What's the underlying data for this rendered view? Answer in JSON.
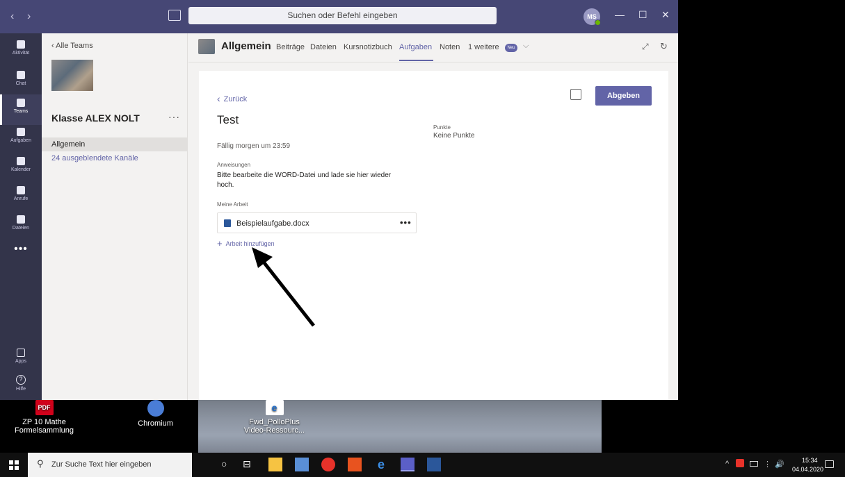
{
  "titlebar": {
    "search_placeholder": "Suchen oder Befehl eingeben",
    "avatar_initials": "MS",
    "back_arrow": "‹",
    "forward_arrow": "›",
    "minimize": "—",
    "maximize": "☐",
    "close": "✕"
  },
  "rail": {
    "items": [
      {
        "label": "Aktivität",
        "icon": "bell-icon"
      },
      {
        "label": "Chat",
        "icon": "chat-icon"
      },
      {
        "label": "Teams",
        "icon": "teams-icon"
      },
      {
        "label": "Aufgaben",
        "icon": "assignments-icon"
      },
      {
        "label": "Kalender",
        "icon": "calendar-icon"
      },
      {
        "label": "Anrufe",
        "icon": "phone-icon"
      },
      {
        "label": "Dateien",
        "icon": "files-icon"
      }
    ],
    "more": "•••",
    "apps_label": "Apps",
    "help_label": "Hilfe",
    "help_glyph": "?"
  },
  "teampanel": {
    "back_label": "‹  Alle Teams",
    "team_name": "Klasse ALEX NOLT",
    "more": "···",
    "channel_active": "Allgemein",
    "hidden_channels": "24 ausgeblendete Kanäle"
  },
  "channel_header": {
    "title": "Allgemein",
    "tabs": [
      "Beiträge",
      "Dateien",
      "Kursnotizbuch",
      "Aufgaben",
      "Noten",
      "1 weitere"
    ],
    "active_tab": "Aufgaben",
    "new_badge": "Neu",
    "chevron": "⌵",
    "expand_icon": "⤢",
    "refresh_icon": "↻"
  },
  "assignment": {
    "back_label": "Zurück",
    "back_chevron": "‹",
    "submit_label": "Abgeben",
    "title": "Test",
    "due": "Fällig morgen um 23:59",
    "points_label": "Punkte",
    "points_value": "Keine Punkte",
    "instructions_label": "Anweisungen",
    "instructions_text": "Bitte bearbeite die WORD-Datei und lade sie hier wieder hoch.",
    "my_work_label": "Meine Arbeit",
    "file_name": "Beispielaufgabe.docx",
    "file_more": "•••",
    "add_work_label": "Arbeit hinzufügen",
    "add_plus": "+"
  },
  "desktop": {
    "icons": [
      {
        "label": "ZP 10 Mathe Formelsammlung",
        "badge": "PDF"
      },
      {
        "label": "Chromium"
      },
      {
        "label": "Fwd_PolloPlus Video-Ressourc...",
        "badge": "e"
      }
    ]
  },
  "taskbar": {
    "search_placeholder": "Zur Suche Text hier eingeben",
    "search_glyph": "⚲",
    "cortana_glyph": "○",
    "taskview_glyph": "⊟",
    "time": "15:34",
    "date": "04.04.2020",
    "tray_chevron": "^",
    "tray_network": "⋮",
    "tray_volume": "🔊"
  },
  "colors": {
    "teams_purple": "#6264a7",
    "titlebar": "#464775",
    "rail": "#33344a"
  }
}
